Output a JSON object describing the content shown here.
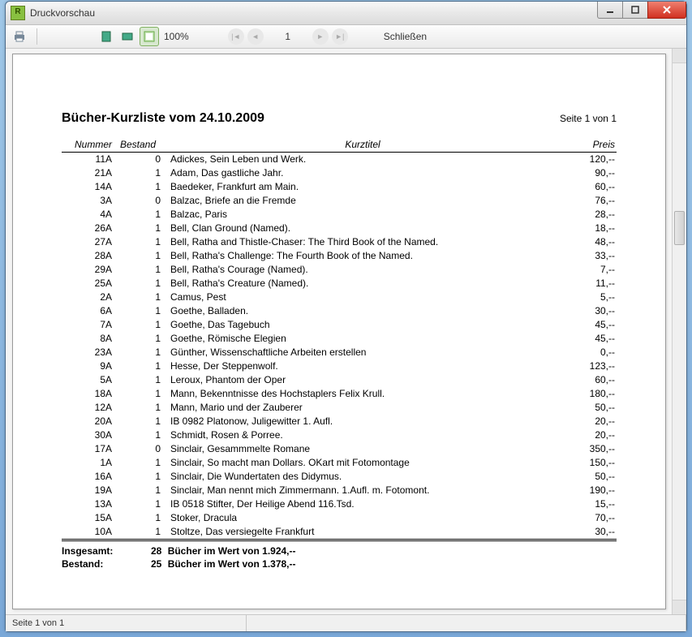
{
  "window": {
    "title": "Druckvorschau",
    "app_icon_letter": "R"
  },
  "toolbar": {
    "zoom_label": "100%",
    "page_value": "1",
    "close_label": "Schließen"
  },
  "document": {
    "title": "Bücher-Kurzliste vom 24.10.2009",
    "page_info": "Seite 1 von 1",
    "columns": {
      "nummer": "Nummer",
      "bestand": "Bestand",
      "kurztitel": "Kurztitel",
      "preis": "Preis"
    },
    "rows": [
      {
        "nummer": "11A",
        "bestand": "0",
        "kurztitel": "Adickes, Sein Leben und Werk.",
        "preis": "120,--"
      },
      {
        "nummer": "21A",
        "bestand": "1",
        "kurztitel": "Adam, Das gastliche Jahr.",
        "preis": "90,--"
      },
      {
        "nummer": "14A",
        "bestand": "1",
        "kurztitel": "Baedeker, Frankfurt am Main.",
        "preis": "60,--"
      },
      {
        "nummer": "3A",
        "bestand": "0",
        "kurztitel": "Balzac, Briefe an die Fremde",
        "preis": "76,--"
      },
      {
        "nummer": "4A",
        "bestand": "1",
        "kurztitel": "Balzac, Paris",
        "preis": "28,--"
      },
      {
        "nummer": "26A",
        "bestand": "1",
        "kurztitel": "Bell, Clan Ground (Named).",
        "preis": "18,--"
      },
      {
        "nummer": "27A",
        "bestand": "1",
        "kurztitel": "Bell, Ratha and Thistle-Chaser: The Third Book of the Named.",
        "preis": "48,--"
      },
      {
        "nummer": "28A",
        "bestand": "1",
        "kurztitel": "Bell, Ratha's Challenge: The Fourth Book of the Named.",
        "preis": "33,--"
      },
      {
        "nummer": "29A",
        "bestand": "1",
        "kurztitel": "Bell, Ratha's Courage (Named).",
        "preis": "7,--"
      },
      {
        "nummer": "25A",
        "bestand": "1",
        "kurztitel": "Bell, Ratha's Creature (Named).",
        "preis": "11,--"
      },
      {
        "nummer": "2A",
        "bestand": "1",
        "kurztitel": "Camus, Pest",
        "preis": "5,--"
      },
      {
        "nummer": "6A",
        "bestand": "1",
        "kurztitel": "Goethe, Balladen.",
        "preis": "30,--"
      },
      {
        "nummer": "7A",
        "bestand": "1",
        "kurztitel": "Goethe, Das Tagebuch",
        "preis": "45,--"
      },
      {
        "nummer": "8A",
        "bestand": "1",
        "kurztitel": "Goethe, Römische Elegien",
        "preis": "45,--"
      },
      {
        "nummer": "23A",
        "bestand": "1",
        "kurztitel": "Günther, Wissenschaftliche Arbeiten erstellen",
        "preis": "0,--"
      },
      {
        "nummer": "9A",
        "bestand": "1",
        "kurztitel": "Hesse, Der Steppenwolf.",
        "preis": "123,--"
      },
      {
        "nummer": "5A",
        "bestand": "1",
        "kurztitel": "Leroux, Phantom der Oper",
        "preis": "60,--"
      },
      {
        "nummer": "18A",
        "bestand": "1",
        "kurztitel": "Mann, Bekenntnisse des Hochstaplers Felix Krull.",
        "preis": "180,--"
      },
      {
        "nummer": "12A",
        "bestand": "1",
        "kurztitel": "Mann, Mario und der Zauberer",
        "preis": "50,--"
      },
      {
        "nummer": "20A",
        "bestand": "1",
        "kurztitel": "IB 0982 Platonow, Juligewitter 1. Aufl.",
        "preis": "20,--"
      },
      {
        "nummer": "30A",
        "bestand": "1",
        "kurztitel": "Schmidt, Rosen & Porree.",
        "preis": "20,--"
      },
      {
        "nummer": "17A",
        "bestand": "0",
        "kurztitel": "Sinclair, Gesammmelte Romane",
        "preis": "350,--"
      },
      {
        "nummer": "1A",
        "bestand": "1",
        "kurztitel": "Sinclair, So macht man Dollars. OKart mit Fotomontage",
        "preis": "150,--"
      },
      {
        "nummer": "16A",
        "bestand": "1",
        "kurztitel": "Sinclair, Die Wundertaten des Didymus.",
        "preis": "50,--"
      },
      {
        "nummer": "19A",
        "bestand": "1",
        "kurztitel": "Sinclair, Man nennt mich Zimmermann. 1.Aufl. m. Fotomont.",
        "preis": "190,--"
      },
      {
        "nummer": "13A",
        "bestand": "1",
        "kurztitel": "IB 0518 Stifter, Der Heilige Abend 116.Tsd.",
        "preis": "15,--"
      },
      {
        "nummer": "15A",
        "bestand": "1",
        "kurztitel": "Stoker, Dracula",
        "preis": "70,--"
      },
      {
        "nummer": "10A",
        "bestand": "1",
        "kurztitel": "Stoltze, Das versiegelte Frankfurt",
        "preis": "30,--"
      }
    ],
    "totals": {
      "insgesamt_label": "Insgesamt:",
      "insgesamt_count": "28",
      "insgesamt_text": "Bücher im Wert von 1.924,--",
      "bestand_label": "Bestand:",
      "bestand_count": "25",
      "bestand_text": "Bücher im Wert von 1.378,--"
    }
  },
  "statusbar": {
    "page_info": "Seite 1 von 1"
  }
}
